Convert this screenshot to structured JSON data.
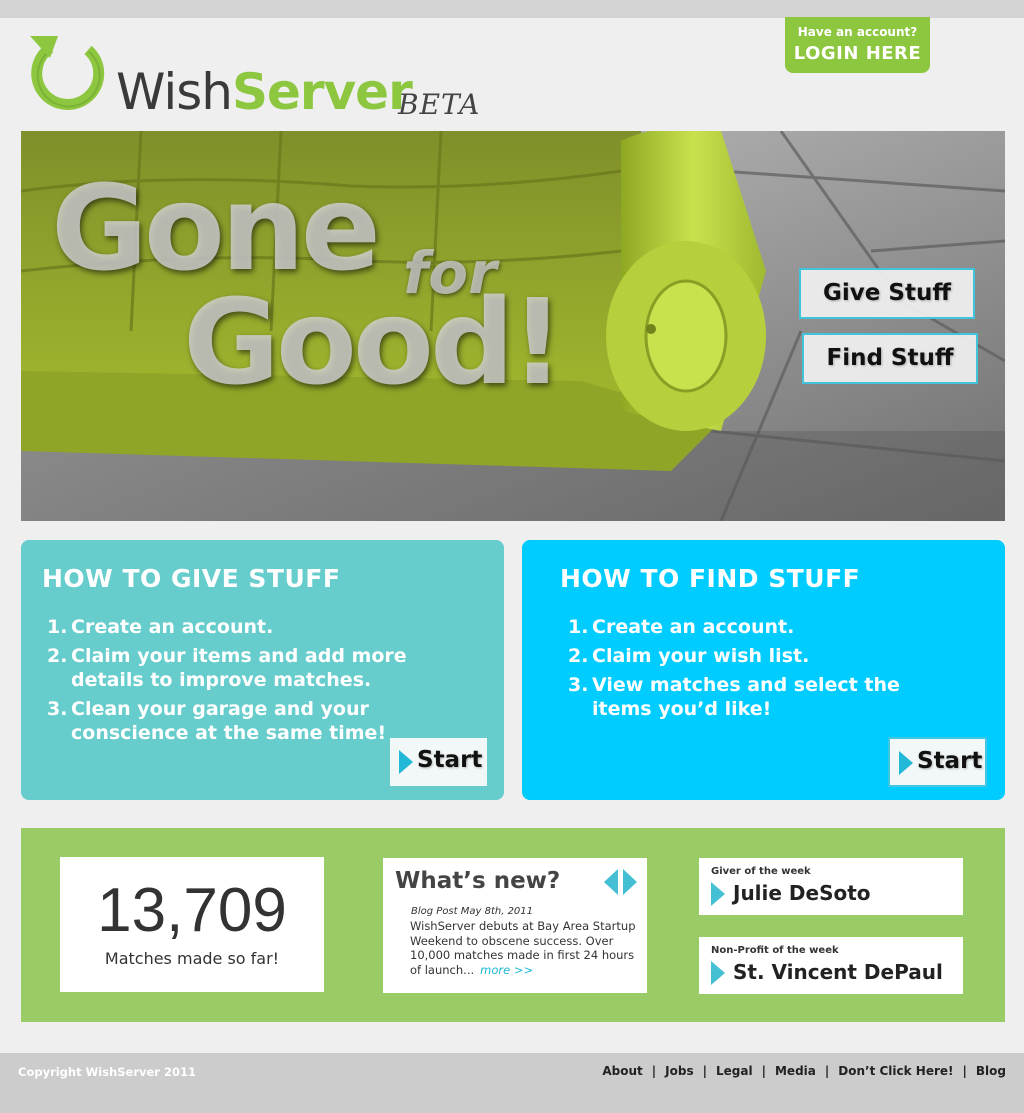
{
  "brand": {
    "name_part1": "Wish",
    "name_part2": "Server",
    "badge": "BETA",
    "colors": {
      "green": "#8dc63f",
      "teal": "#66cccc",
      "cyan": "#00ccff",
      "band": "#99cc66",
      "arrow": "#45bfd3"
    }
  },
  "login": {
    "prompt": "Have an account?",
    "label": "LOGIN HERE"
  },
  "hero": {
    "line1": "Gone",
    "line2": "for",
    "line3": "Good!",
    "give_button": "Give Stuff",
    "find_button": "Find Stuff"
  },
  "give_panel": {
    "title": "HOW TO GIVE STUFF",
    "steps": [
      {
        "num": "1.",
        "text": "Create an account."
      },
      {
        "num": "2.",
        "text": "Claim your items and add more details to improve matches."
      },
      {
        "num": "3.",
        "text": "Clean your garage and your conscience at the same time!"
      }
    ],
    "start_label": "Start"
  },
  "find_panel": {
    "title": "HOW TO FIND STUFF",
    "steps": [
      {
        "num": "1.",
        "text": "Create an account."
      },
      {
        "num": "2.",
        "text": "Claim your wish list."
      },
      {
        "num": "3.",
        "text": "View matches and select the items you’d like!"
      }
    ],
    "start_label": "Start"
  },
  "stats": {
    "matches_count": "13,709",
    "matches_label": "Matches made so far!"
  },
  "news": {
    "title": "What’s new?",
    "date": "Blog Post May 8th, 2011",
    "body": "WishServer debuts at Bay Area Startup Weekend to obscene success. Over 10,000 matches made in first 24 hours of launch...",
    "more": "more >>"
  },
  "giver_of_week": {
    "label": "Giver of the week",
    "name": "Julie DeSoto"
  },
  "nonprofit_of_week": {
    "label": "Non-Profit of the week",
    "name": "St. Vincent DePaul"
  },
  "footer": {
    "copyright": "Copyright WishServer 2011",
    "links": [
      "About",
      "Jobs",
      "Legal",
      "Media",
      "Don’t Click Here!",
      "Blog"
    ],
    "separator": "|"
  }
}
